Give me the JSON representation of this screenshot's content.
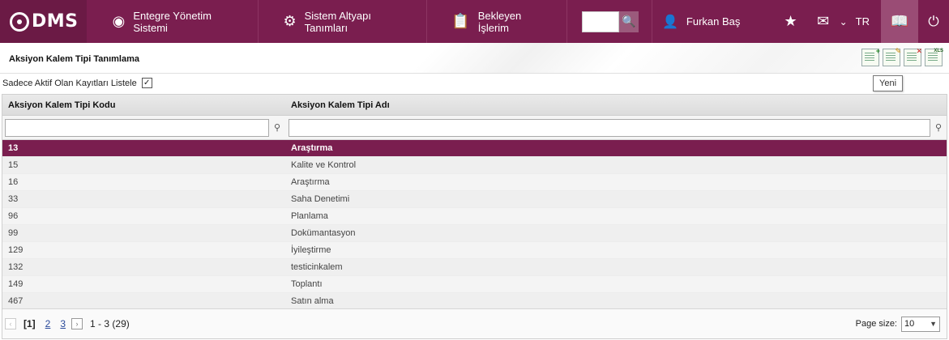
{
  "topbar": {
    "logo": "DMS",
    "nav": [
      {
        "label": "Entegre Yönetim Sistemi",
        "icon": "circle-logo-icon"
      },
      {
        "label": "Sistem Altyapı Tanımları",
        "icon": "gear-icon"
      },
      {
        "label": "Bekleyen İşlerim",
        "icon": "clipboard-icon"
      }
    ],
    "search": {
      "placeholder": ""
    },
    "user_name": "Furkan Baş",
    "language": "TR"
  },
  "page": {
    "title": "Aksiyon Kalem Tipi Tanımlama",
    "tooltip": "Yeni",
    "active_filter_label": "Sadece Aktif Olan Kayıtları Listele",
    "active_filter_checked": "✓"
  },
  "toolbar": {
    "add_badge": "+",
    "edit_badge": "✎",
    "delete_badge": "✕",
    "export_badge": "XLS"
  },
  "grid": {
    "columns": [
      "Aksiyon Kalem Tipi Kodu",
      "Aksiyon Kalem Tipi Adı"
    ],
    "rows": [
      {
        "code": "13",
        "name": "Araştırma"
      },
      {
        "code": "15",
        "name": "Kalite ve Kontrol"
      },
      {
        "code": "16",
        "name": "Araştırma"
      },
      {
        "code": "33",
        "name": "Saha Denetimi"
      },
      {
        "code": "96",
        "name": "Planlama"
      },
      {
        "code": "99",
        "name": "Dokümantasyon"
      },
      {
        "code": "129",
        "name": "İyileştirme"
      },
      {
        "code": "132",
        "name": "testicinkalem"
      },
      {
        "code": "149",
        "name": "Toplantı"
      },
      {
        "code": "467",
        "name": "Satın alma"
      }
    ],
    "selected_index": 0
  },
  "pager": {
    "current": "[1]",
    "pages": [
      "2",
      "3"
    ],
    "info": "1 - 3 (29)",
    "page_size_label": "Page size:",
    "page_size": "10"
  },
  "colors": {
    "brand": "#7a1e4f",
    "selected_row": "#7a1e4f"
  }
}
